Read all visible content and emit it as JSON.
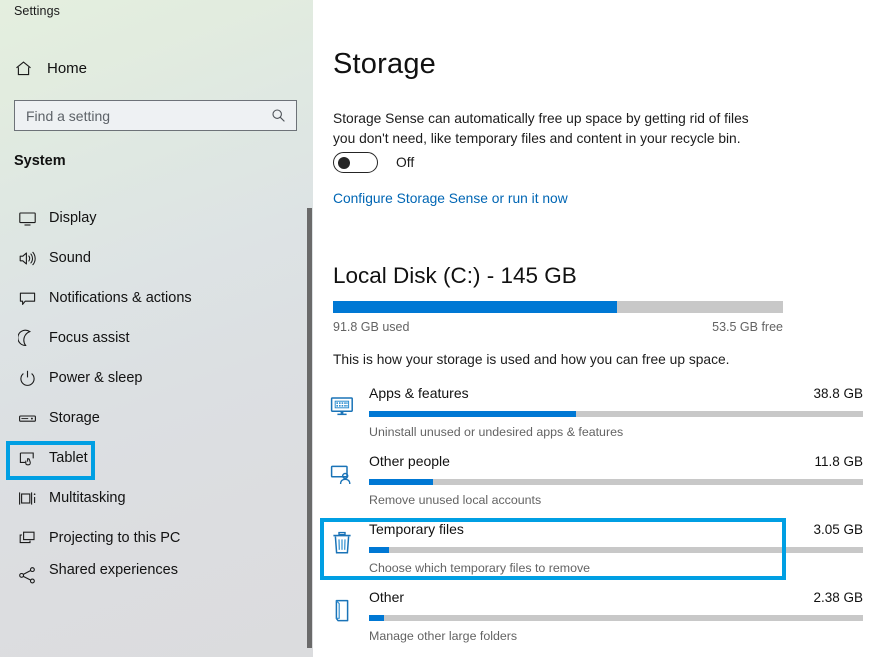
{
  "app": {
    "title": "Settings"
  },
  "sidebar": {
    "home": {
      "label": "Home",
      "icon": "home-icon"
    },
    "search": {
      "placeholder": "Find a setting",
      "value": "",
      "icon": "search-icon"
    },
    "section_heading": "System",
    "items": [
      {
        "label": "Display",
        "icon": "monitor-icon",
        "selected": false
      },
      {
        "label": "Sound",
        "icon": "speaker-icon",
        "selected": false
      },
      {
        "label": "Notifications & actions",
        "icon": "chat-bubble-icon",
        "selected": false
      },
      {
        "label": "Focus assist",
        "icon": "moon-icon",
        "selected": false
      },
      {
        "label": "Power & sleep",
        "icon": "power-icon",
        "selected": false
      },
      {
        "label": "Storage",
        "icon": "drive-icon",
        "selected": true
      },
      {
        "label": "Tablet",
        "icon": "tablet-hand-icon",
        "selected": false
      },
      {
        "label": "Multitasking",
        "icon": "multitasking-icon",
        "selected": false
      },
      {
        "label": "Projecting to this PC",
        "icon": "projecting-icon",
        "selected": false
      },
      {
        "label": "Shared experiences",
        "icon": "share-nodes-icon",
        "selected": false
      }
    ]
  },
  "main": {
    "page_title": "Storage",
    "storage_sense": {
      "description": "Storage Sense can automatically free up space by getting rid of files you don't need, like temporary files and content in your recycle bin.",
      "toggle_state": "Off",
      "configure_link": "Configure Storage Sense or run it now"
    },
    "disk": {
      "title": "Local Disk (C:) - 145 GB",
      "used_label": "91.8 GB used",
      "free_label": "53.5 GB free",
      "used_percent": 63,
      "usage_note": "This is how your storage is used and how you can free up space."
    },
    "categories": [
      {
        "name": "Apps & features",
        "size": "38.8 GB",
        "subtitle": "Uninstall unused or undesired apps & features",
        "percent": 42,
        "icon": "apps-monitor-icon",
        "highlighted": false
      },
      {
        "name": "Other people",
        "size": "11.8 GB",
        "subtitle": "Remove unused local accounts",
        "percent": 13,
        "icon": "user-monitor-icon",
        "highlighted": false
      },
      {
        "name": "Temporary files",
        "size": "3.05 GB",
        "subtitle": "Choose which temporary files to remove",
        "percent": 4,
        "icon": "trash-icon",
        "highlighted": true
      },
      {
        "name": "Other",
        "size": "2.38 GB",
        "subtitle": "Manage other large folders",
        "percent": 3,
        "icon": "document-icon",
        "highlighted": false
      }
    ]
  },
  "colors": {
    "accent_blue": "#0078d4",
    "highlight_cyan": "#009fe3",
    "link_blue": "#0066b4",
    "track_gray": "#c8c8c8"
  }
}
